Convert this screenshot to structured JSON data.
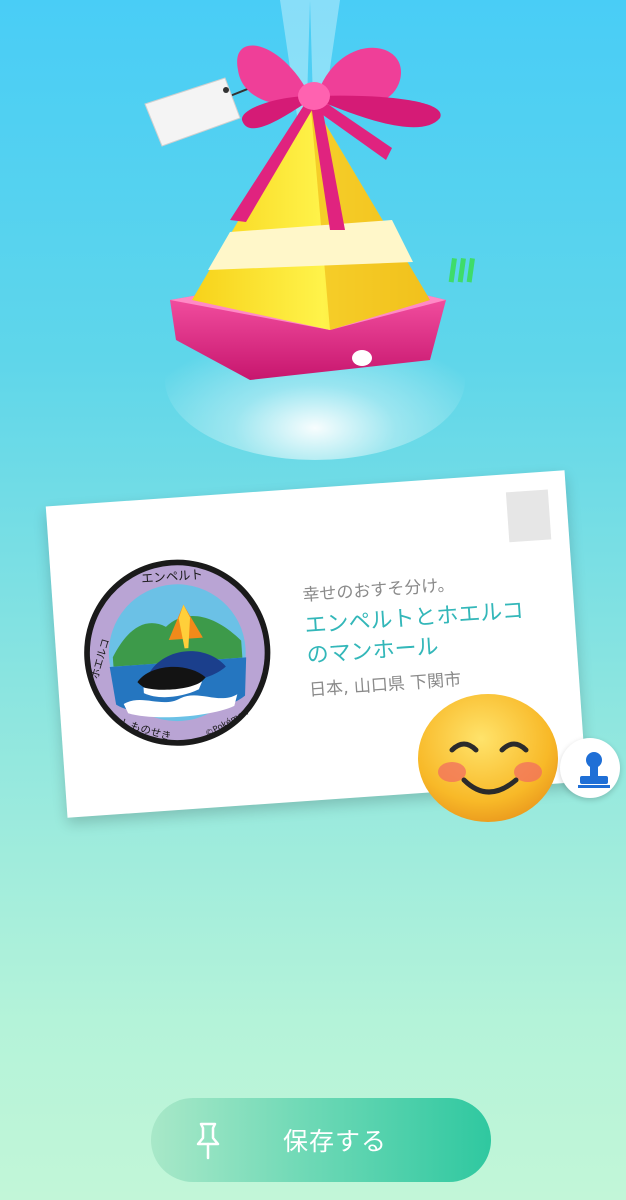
{
  "gift": {
    "icon": "gift-box-icon"
  },
  "postcard": {
    "subtitle": "幸せのおすそ分け。",
    "title": "エンペルトとホエルコのマンホール",
    "location": "日本, 山口県 下関市",
    "image": "manhole-cover-image",
    "manhole_text": {
      "top": "エンペルト",
      "left": "ホエルコ",
      "bottom_left": "しものせき",
      "bottom_right": "©Pokémon"
    }
  },
  "overlay": {
    "emoji": "smiling-face-emoji"
  },
  "stamp_button": {
    "icon": "stamp-icon"
  },
  "save_button": {
    "label": "保存する",
    "icon": "pin-icon"
  },
  "colors": {
    "accent_title": "#33b7b9",
    "muted_text": "#8a8a8a",
    "button_start": "#a8e8c8",
    "button_end": "#2fc8a0"
  }
}
